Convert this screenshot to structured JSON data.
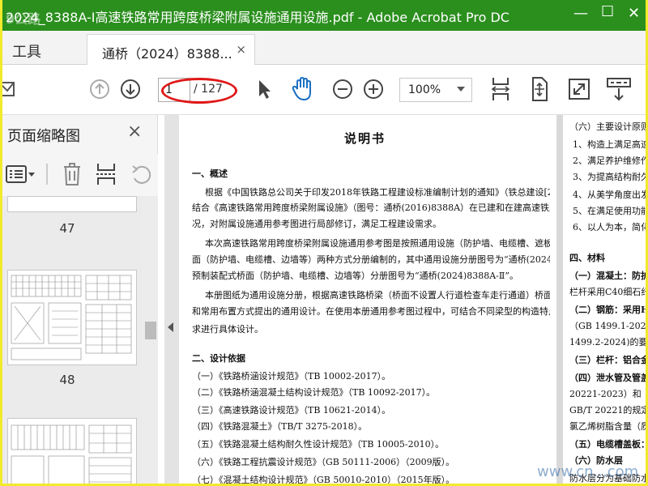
{
  "window": {
    "title": "2024_8388A-Ⅰ高速铁路常用跨度桥梁附属设施通用设施.pdf - Adobe Acrobat Pro DC",
    "watermark_tl": "9公路",
    "watermark_br": "www.cn...com"
  },
  "tabs": {
    "tools_label": "工具",
    "doc_tab_title": "通桥（2024）8388...",
    "doc_tab_close": "×"
  },
  "toolbar": {
    "current_page": "1",
    "total_pages": "/ 127",
    "zoom": "100%"
  },
  "sidepanel": {
    "title": "页面缩略图",
    "close": "×",
    "thumbs": [
      {
        "label": "47"
      },
      {
        "label": "48"
      },
      {
        "label": ""
      }
    ]
  },
  "page1": {
    "heading": "说明书",
    "lines": [
      {
        "text": "一、概述",
        "bold": true
      },
      {
        "text": "根据《中国铁路总公司关于印发2018年铁路工程建设标准编制计划的通知》（铁总建设[2018]180号），",
        "bold": false
      },
      {
        "text": "结合《高速铁路常用跨度桥梁附属设施》（图号：通桥(2016)8388A）在已建和在建高速铁路中的实际使用情",
        "bold": false
      },
      {
        "text": "况，对附属设施通用参考图进行局部修订，满足工程建设需求。",
        "bold": false
      },
      {
        "text": "本次高速铁路常用跨度桥梁附属设施通用参考图是按照通用设施（防护墙、电缆槽、遮板等）和预制装配式桥",
        "bold": false
      },
      {
        "text": "面（防护墙、电缆槽、边墙等）两种方式分册编制的，其中通用设施分册图号为“通桥(2024)8388A-Ⅰ”，",
        "bold": false
      },
      {
        "text": "预制装配式桥面（防护墙、电缆槽、边墙等）分册图号为“通桥(2024)8388A-Ⅱ”。",
        "bold": false
      },
      {
        "text": "本册图纸为通用设施分册，根据高速铁路桥梁（桥面不设置人行道检查车走行通道）桥面附属设施的共性要求",
        "bold": false
      },
      {
        "text": "和常用布置方式提出的通用设计。在使用本册通用参考图过程中，可结合不同梁型的构造特点及附属设施的功能要",
        "bold": false
      },
      {
        "text": "求进行具体设计。",
        "bold": false
      },
      {
        "text": "二、设计依据",
        "bold": true
      },
      {
        "text": "（一）《铁路桥涵设计规范》（TB 10002-2017）。",
        "bold": false
      },
      {
        "text": "（二）《铁路桥涵混凝土结构设计规范》（TB 10092-2017）。",
        "bold": false
      },
      {
        "text": "（三）《高速铁路设计规范》（TB 10621-2014）。",
        "bold": false
      },
      {
        "text": "（四）《铁路混凝土》（TB/T 3275-2018）。",
        "bold": false
      },
      {
        "text": "（五）《铁路混凝土结构耐久性设计规范》（TB 10005-2010）。",
        "bold": false
      },
      {
        "text": "（六）《铁路工程抗震设计规范》（GB 50111-2006）（2009版）。",
        "bold": false
      },
      {
        "text": "（七）《混凝土结构设计规范》（GB 50010-2010）（2015年版）。",
        "bold": false
      }
    ]
  },
  "page2": {
    "lines": [
      {
        "text": "（六）主要设计原则",
        "bold": false
      },
      {
        "text": "1、构造上满足高速铁",
        "bold": false
      },
      {
        "text": "2、满足养护维修作业",
        "bold": false
      },
      {
        "text": "3、为提高结构耐久性",
        "bold": false
      },
      {
        "text": "4、从美学角度出发，考",
        "bold": false
      },
      {
        "text": "5、在满足使用功能",
        "bold": false
      },
      {
        "text": "6、以人为本，简化施",
        "bold": false
      },
      {
        "text": "四、材料",
        "bold": true
      },
      {
        "text": "（一）混凝土：防护（挡",
        "bold": true
      },
      {
        "text": "栏杆采用C40细石纤维",
        "bold": false
      },
      {
        "text": "（二）钢筋：采用HPB30",
        "bold": true
      },
      {
        "text": "（GB 1499.1-2024）",
        "bold": false
      },
      {
        "text": "1499.2-2024)的要求",
        "bold": false
      },
      {
        "text": "（三）栏杆：铝合金，性",
        "bold": true
      },
      {
        "text": "（四）泄水管及管盖：PV",
        "bold": true
      },
      {
        "text": "20221-2023）和《建",
        "bold": false
      },
      {
        "text": "GB/T 20221的规定根",
        "bold": false
      },
      {
        "text": "氯乙烯树脂含量（质量",
        "bold": false
      },
      {
        "text": "（五）电缆槽盖板：采用",
        "bold": true
      },
      {
        "text": "（六）防水层",
        "bold": true
      },
      {
        "text": "防水层分为基础防水",
        "bold": false
      }
    ]
  }
}
